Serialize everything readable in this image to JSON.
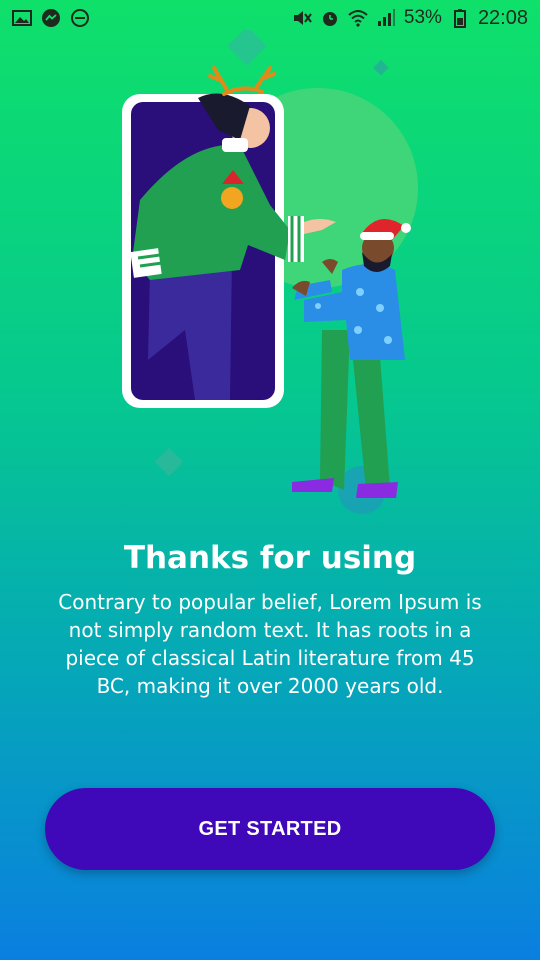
{
  "status_bar": {
    "battery_percent": "53%",
    "time": "22:08",
    "icons": [
      "gallery-icon",
      "messenger-icon",
      "do-not-disturb-icon",
      "mute-icon",
      "alarm-icon",
      "wifi-icon",
      "signal-icon",
      "battery-icon"
    ]
  },
  "onboarding": {
    "title": "Thanks for using",
    "description": "Contrary to popular belief, Lorem Ipsum is not simply random text. It has roots in a piece of classical Latin literature from 45 BC, making it over 2000 years old.",
    "button_label": "GET STARTED"
  },
  "colors": {
    "gradient_top": "#0fe06a",
    "gradient_bottom": "#0a7fe0",
    "button": "#3f08b8",
    "phone_screen": "#2a0e7a"
  }
}
